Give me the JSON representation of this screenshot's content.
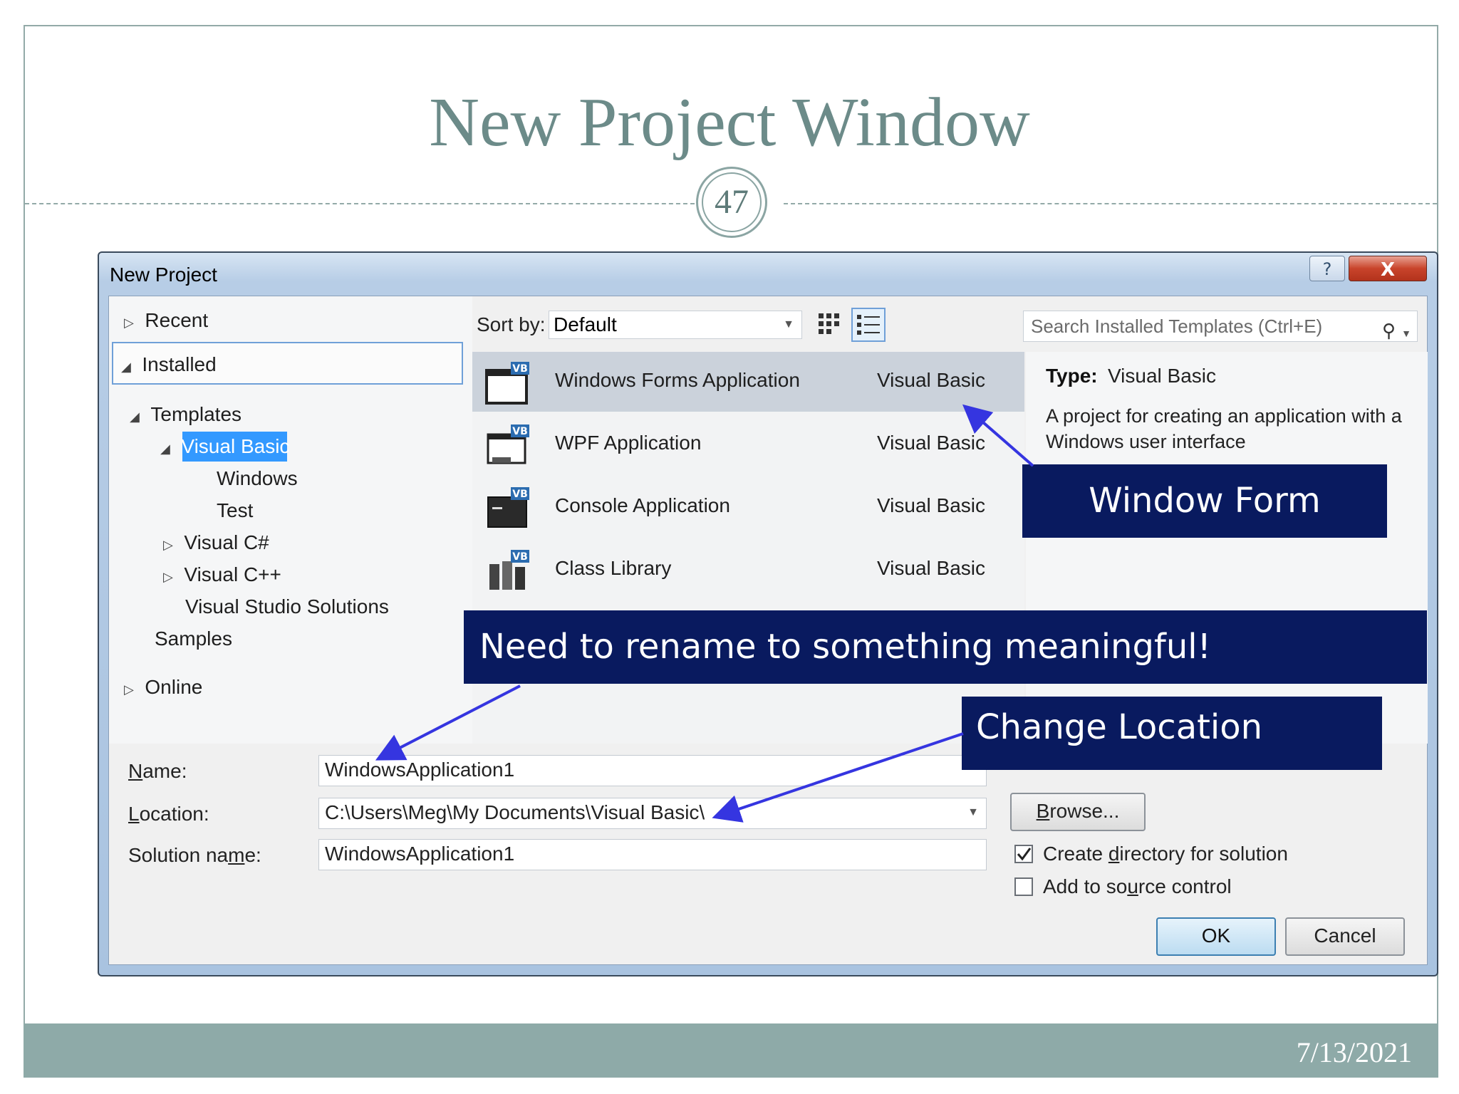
{
  "slide": {
    "title": "New Project Window",
    "page_number": "47",
    "date": "7/13/2021"
  },
  "dialog": {
    "title": "New Project",
    "help_icon": "?",
    "close_icon": "X"
  },
  "tree": {
    "recent": "Recent",
    "installed": "Installed",
    "templates": "Templates",
    "visual_basic": "Visual Basic",
    "windows": "Windows",
    "test": "Test",
    "visual_csharp": "Visual C#",
    "visual_cpp": "Visual C++",
    "vs_solutions": "Visual Studio Solutions",
    "samples": "Samples",
    "online": "Online"
  },
  "toolbar": {
    "sort_label": "Sort by:",
    "sort_value": "Default",
    "search_placeholder": "Search Installed Templates (Ctrl+E)"
  },
  "templates": [
    {
      "name": "Windows Forms Application",
      "lang": "Visual Basic",
      "badge": "VB",
      "selected": true
    },
    {
      "name": "WPF Application",
      "lang": "Visual Basic",
      "badge": "VB",
      "selected": false
    },
    {
      "name": "Console Application",
      "lang": "Visual Basic",
      "badge": "VB",
      "selected": false
    },
    {
      "name": "Class Library",
      "lang": "Visual Basic",
      "badge": "VB",
      "selected": false
    }
  ],
  "info": {
    "type_label": "Type:",
    "type_value": "Visual Basic",
    "description": "A project for creating an application with a Windows user interface"
  },
  "fields": {
    "name_label_u": "N",
    "name_label_rest": "ame:",
    "name_value": "WindowsApplication1",
    "location_label_u": "L",
    "location_label_rest": "ocation:",
    "location_value": "C:\\Users\\Meg\\My Documents\\Visual Basic\\",
    "solution_label_pre": "Solution na",
    "solution_label_u": "m",
    "solution_label_post": "e:",
    "solution_value": "WindowsApplication1"
  },
  "buttons": {
    "browse_u": "B",
    "browse_rest": "rowse...",
    "ok": "OK",
    "cancel": "Cancel"
  },
  "checkboxes": {
    "create_dir_pre": "Create ",
    "create_dir_u": "d",
    "create_dir_post": "irectory for solution",
    "create_dir_checked": true,
    "source_pre": "Add to so",
    "source_u": "u",
    "source_post": "rce control",
    "source_checked": false
  },
  "callouts": {
    "window_form": "Window Form",
    "rename": "Need to rename to something meaningful!",
    "change_location": "Change Location"
  },
  "colors": {
    "callout_bg": "#091a5f",
    "title_color": "#6c8b89",
    "footer_band": "#8eaaa8",
    "selection_blue": "#3399ff",
    "arrow_color": "#3535e0"
  }
}
